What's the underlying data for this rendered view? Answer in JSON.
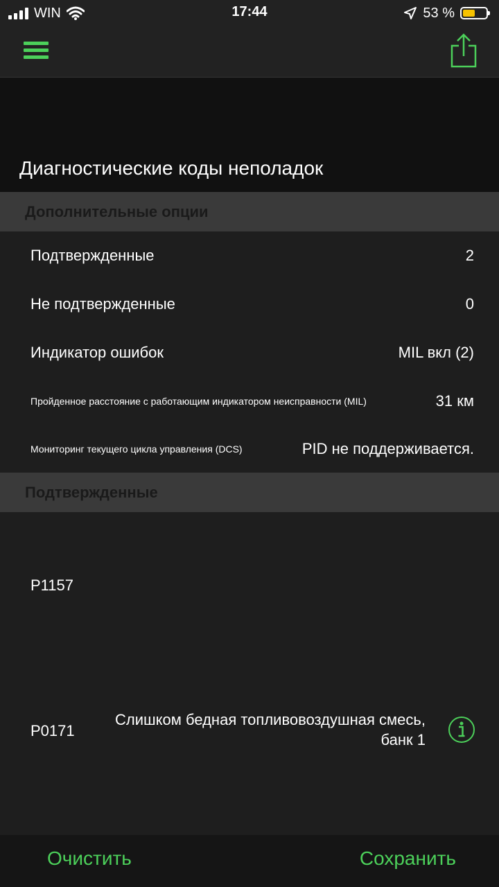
{
  "status_bar": {
    "carrier": "WIN",
    "time": "17:44",
    "battery_percent": "53 %",
    "battery_level": 0.53,
    "icons": [
      "signal-icon",
      "wifi-icon",
      "location-arrow-icon",
      "battery-icon"
    ]
  },
  "nav": {
    "menu_icon": "hamburger-menu-icon",
    "share_icon": "share-icon",
    "accent_color": "#4cd05a"
  },
  "page": {
    "title": "Диагностические коды неполадок"
  },
  "options_section": {
    "header": "Дополнительные опции",
    "rows": [
      {
        "label": "Подтвержденные",
        "value": "2"
      },
      {
        "label": "Не подтвержденные",
        "value": "0"
      },
      {
        "label": "Индикатор ошибок",
        "value": "MIL вкл (2)"
      },
      {
        "label": "Пройденное расстояние с работающим индикатором неисправности (MIL)",
        "value": "31 км"
      },
      {
        "label": "Мониторинг текущего цикла управления (DCS)",
        "value": "PID не поддерживается."
      }
    ]
  },
  "confirmed_section": {
    "header": "Подтвержденные",
    "codes": [
      {
        "code": "P1157",
        "description": ""
      },
      {
        "code": "P0171",
        "description": "Слишком бедная топливовоздушная смесь, банк 1",
        "icon": "info-icon"
      }
    ]
  },
  "bottom_bar": {
    "clear_label": "Очистить",
    "save_label": "Сохранить"
  }
}
